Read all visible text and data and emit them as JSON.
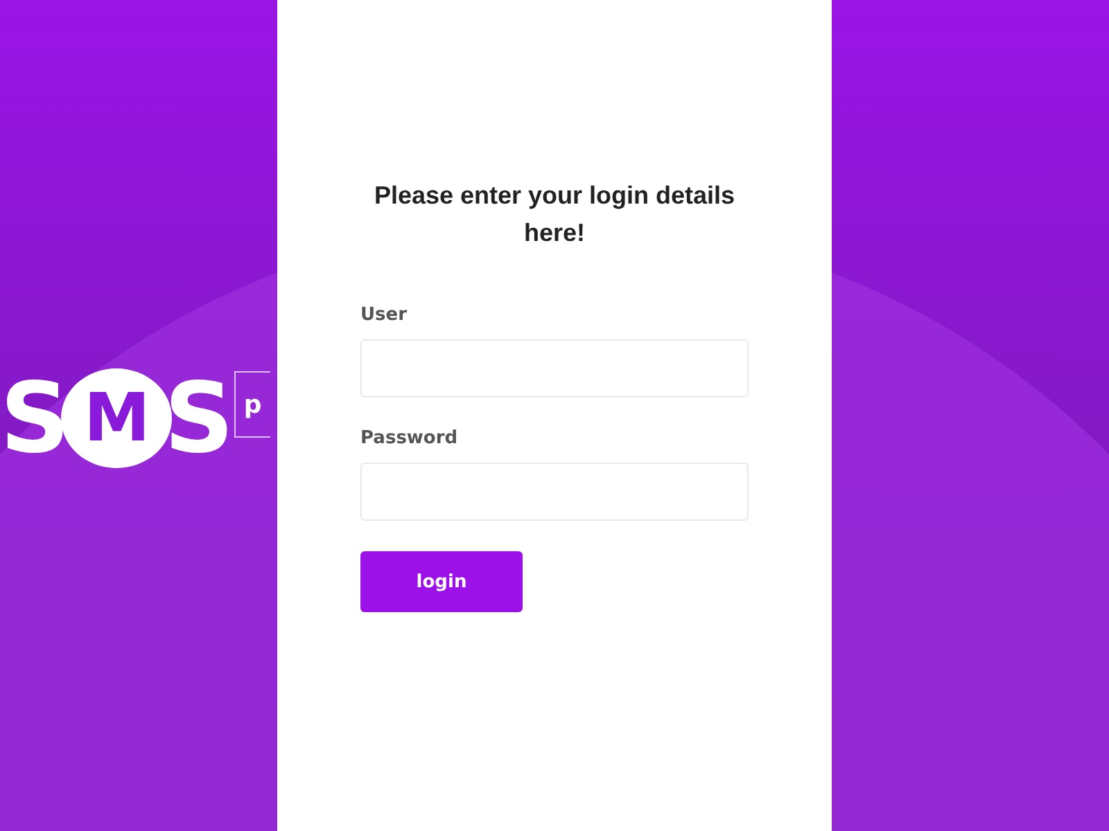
{
  "logo": {
    "letter_1": "S",
    "bubble_letter": "M",
    "letter_2": "S",
    "suffix": "p"
  },
  "login_form": {
    "heading": "Please enter your login details here!",
    "fields": [
      {
        "label": "User"
      },
      {
        "label": "Password"
      }
    ],
    "submit_button": "login"
  }
}
